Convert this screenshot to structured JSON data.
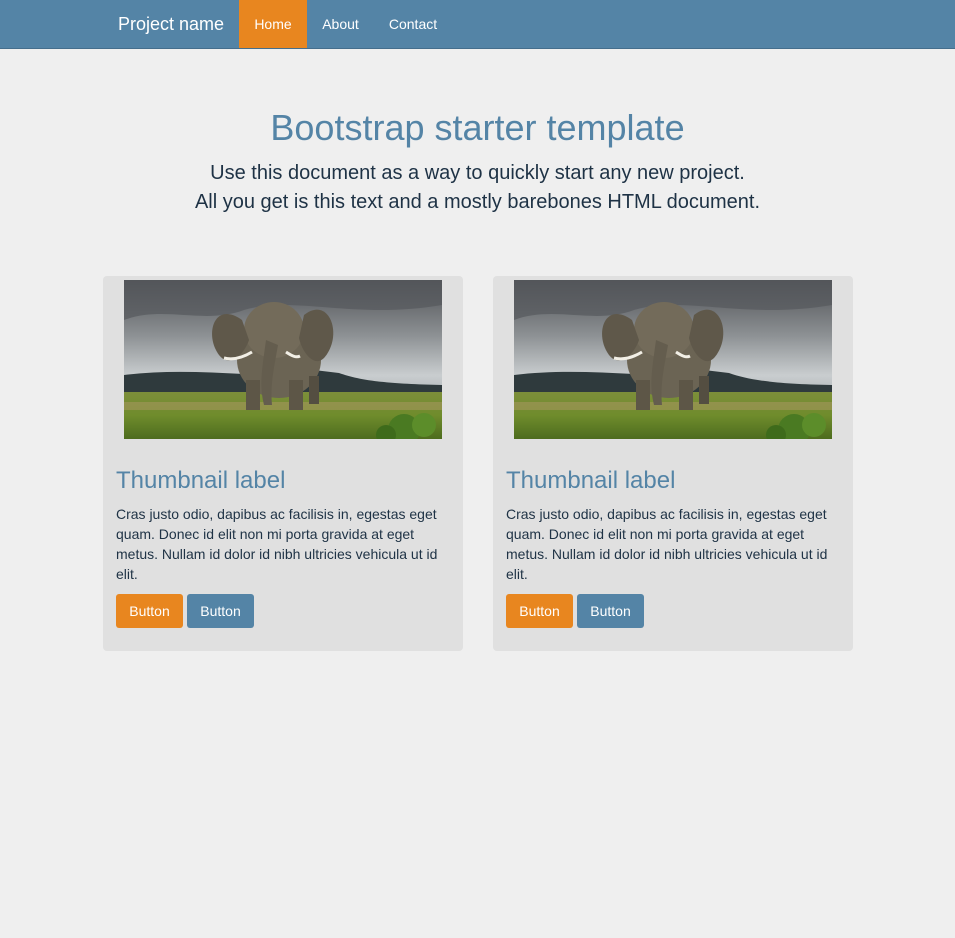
{
  "navbar": {
    "brand": "Project name",
    "items": [
      {
        "label": "Home",
        "active": true
      },
      {
        "label": "About",
        "active": false
      },
      {
        "label": "Contact",
        "active": false
      }
    ]
  },
  "hero": {
    "title": "Bootstrap starter template",
    "lead_line1": "Use this document as a way to quickly start any new project.",
    "lead_line2": "All you get is this text and a mostly barebones HTML document."
  },
  "thumbnails": [
    {
      "image": "elephant-in-grassland-photo",
      "label": "Thumbnail label",
      "text": "Cras justo odio, dapibus ac facilisis in, egestas eget quam. Donec id elit non mi porta gravida at eget metus. Nullam id dolor id nibh ultricies vehicula ut id elit.",
      "primary_button": "Button",
      "secondary_button": "Button"
    },
    {
      "image": "elephant-in-grassland-photo",
      "label": "Thumbnail label",
      "text": "Cras justo odio, dapibus ac facilisis in, egestas eget quam. Donec id elit non mi porta gravida at eget metus. Nullam id dolor id nibh ultricies vehicula ut id elit.",
      "primary_button": "Button",
      "secondary_button": "Button"
    }
  ],
  "colors": {
    "navbar": "#5484a6",
    "accent": "#e8861f",
    "background": "#efefef",
    "thumbnail_bg": "#e0e0e0"
  }
}
